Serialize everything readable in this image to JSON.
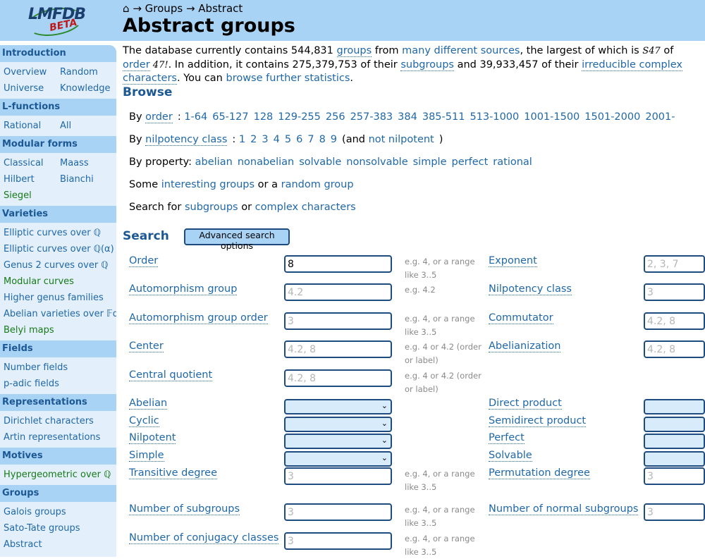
{
  "breadcrumb": {
    "home_icon": "⌂",
    "sep": "→",
    "items": [
      "Groups",
      "Abstract"
    ]
  },
  "page_title": "Abstract groups",
  "logo": {
    "main": "LMFDB",
    "sub": "BETA"
  },
  "sidebar": {
    "introduction": {
      "title": "Introduction",
      "rows": [
        [
          "Overview",
          "Random"
        ],
        [
          "Universe",
          "Knowledge"
        ]
      ]
    },
    "lfunctions": {
      "title": "L-functions",
      "rows": [
        [
          "Rational",
          "All"
        ]
      ]
    },
    "modular": {
      "title": "Modular forms",
      "rows": [
        [
          "Classical",
          "Maass"
        ],
        [
          "Hilbert",
          "Bianchi"
        ],
        [
          "Siegel"
        ]
      ]
    },
    "varieties": {
      "title": "Varieties",
      "items": [
        "Elliptic curves over ℚ",
        "Elliptic curves over ℚ(α)",
        "Genus 2 curves over ℚ",
        "Modular curves",
        "Higher genus families",
        "Abelian varieties over 𝔽q",
        "Belyi maps"
      ]
    },
    "fields": {
      "title": "Fields",
      "items": [
        "Number fields",
        "p-adic fields"
      ]
    },
    "representations": {
      "title": "Representations",
      "items": [
        "Dirichlet characters",
        "Artin representations"
      ]
    },
    "motives": {
      "title": "Motives",
      "items": [
        "Hypergeometric over ℚ"
      ]
    },
    "groups": {
      "title": "Groups",
      "items": [
        "Galois groups",
        "Sato-Tate groups",
        "Abstract"
      ]
    }
  },
  "intro": {
    "p1": "The database currently contains 544,831 ",
    "groups_link": "groups",
    "p2": " from ",
    "sources_link": "many different sources",
    "p3": ", the largest of which is ",
    "largest": "S47",
    "p4": " of ",
    "order_link": "order",
    "order_val": " 47!",
    "p5": ". In addition, it contains 275,379,753 of their ",
    "subgroups_link": "subgroups",
    "p6": " and 39,933,457 of their ",
    "chars_link": "irreducible complex characters",
    "p7": ". You can ",
    "stats_link": "browse further statistics",
    "p8": "."
  },
  "browse": {
    "title": "Browse",
    "by_order_label": "By ",
    "order_knowl": "order",
    "order_ranges": [
      "1-64",
      "65-127",
      "128",
      "129-255",
      "256",
      "257-383",
      "384",
      "385-511",
      "513-1000",
      "1001-1500",
      "1501-2000",
      "2001-"
    ],
    "nil_knowl": "nilpotency class",
    "nil_values": [
      "1",
      "2",
      "3",
      "4",
      "5",
      "6",
      "7",
      "8",
      "9"
    ],
    "not_nil_pre": "(and ",
    "not_nil_link": "not nilpotent",
    "not_nil_post": ")",
    "by_property_label": "By property:",
    "properties": [
      "abelian",
      "nonabelian",
      "solvable",
      "nonsolvable",
      "simple",
      "perfect",
      "rational"
    ],
    "some_label": "Some ",
    "interesting_link": "interesting groups",
    "or_a": " or a ",
    "random_link": "random group",
    "search_for": "Search for ",
    "subgroups_link": "subgroups",
    "or": " or ",
    "complex_link": "complex characters"
  },
  "search": {
    "title": "Search",
    "advanced_button": "Advanced search options",
    "left": [
      {
        "label": "Order",
        "value": "8",
        "placeholder": "",
        "hint": "e.g. 4, or a range like 3..5"
      },
      {
        "label": "Automorphism group",
        "value": "",
        "placeholder": "4.2",
        "hint": "e.g. 4.2"
      },
      {
        "label": "Automorphism group order",
        "value": "",
        "placeholder": "3",
        "hint": "e.g. 4, or a range like 3..5"
      },
      {
        "label": "Center",
        "value": "",
        "placeholder": "4.2, 8",
        "hint": "e.g. 4 or 4.2 (order or label)"
      },
      {
        "label": "Central quotient",
        "value": "",
        "placeholder": "4.2, 8",
        "hint": "e.g. 4 or 4.2 (order or label)"
      }
    ],
    "left_selects": [
      "Abelian",
      "Cyclic",
      "Nilpotent",
      "Simple"
    ],
    "left_lower": [
      {
        "label": "Transitive degree",
        "placeholder": "3",
        "hint": "e.g. 4, or a range like 3..5"
      },
      {
        "label": "Number of subgroups",
        "placeholder": "3",
        "hint": "e.g. 4, or a range like 3..5"
      },
      {
        "label": "Number of conjugacy classes",
        "placeholder": "3",
        "hint": "e.g. 4, or a range like 3..5"
      }
    ],
    "right": [
      {
        "label": "Exponent",
        "placeholder": "2, 3, 7"
      },
      {
        "label": "Nilpotency class",
        "placeholder": "3"
      },
      {
        "label": "Commutator",
        "placeholder": "4.2, 8"
      },
      {
        "label": "Abelianization",
        "placeholder": "4.2, 8"
      }
    ],
    "right_selects": [
      "Direct product",
      "Semidirect product",
      "Perfect",
      "Solvable"
    ],
    "right_lower": [
      {
        "label": "Permutation degree",
        "placeholder": "3"
      },
      {
        "label": "Number of normal subgroups",
        "placeholder": "3"
      }
    ]
  }
}
